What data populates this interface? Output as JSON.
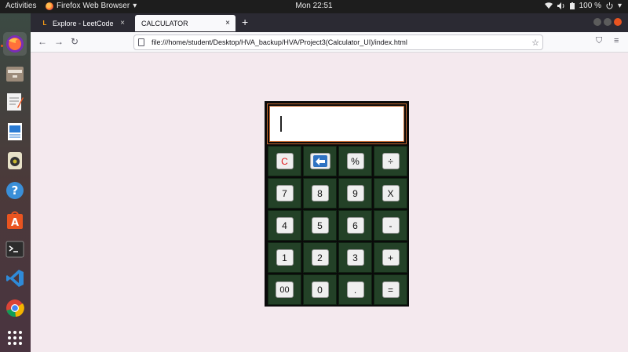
{
  "topbar": {
    "activities": "Activities",
    "app": "Firefox Web Browser",
    "app_arrow": "▾",
    "clock": "Mon 22:51",
    "battery": "100 %",
    "icons": [
      "wifi-icon",
      "speaker-icon",
      "power-icon"
    ]
  },
  "dock": {
    "items": [
      "firefox",
      "files",
      "text-editor",
      "writer",
      "rhythmbox",
      "help",
      "software",
      "terminal",
      "vscode",
      "chrome",
      "app-grid"
    ]
  },
  "browser": {
    "tabs": [
      {
        "title": "Explore - LeetCode",
        "active": false,
        "favicon": "L"
      },
      {
        "title": "CALCULATOR",
        "active": true
      }
    ],
    "close_glyph": "×",
    "new_tab": "+",
    "url": "file:///home/student/Desktop/HVA_backup/HVA/Project3(Calculator_UI)/index.html",
    "nav": {
      "back": "←",
      "forward": "→",
      "reload": "↻",
      "star": "☆",
      "pocket": "⛉",
      "menu": "≡"
    }
  },
  "calculator": {
    "display_value": "",
    "keys": [
      [
        "C",
        "←",
        "%",
        "÷"
      ],
      [
        "7",
        "8",
        "9",
        "X"
      ],
      [
        "4",
        "5",
        "6",
        "-"
      ],
      [
        "1",
        "2",
        "3",
        "+"
      ],
      [
        "00",
        "0",
        ".",
        "="
      ]
    ]
  },
  "colors": {
    "page_bg": "#f4e9ee",
    "calc_body": "#0a0a0a",
    "cell_bg": "#234127",
    "display_border": "#c46a32",
    "clear_key": "#e0171a",
    "backspace_key": "#2f72c2"
  }
}
